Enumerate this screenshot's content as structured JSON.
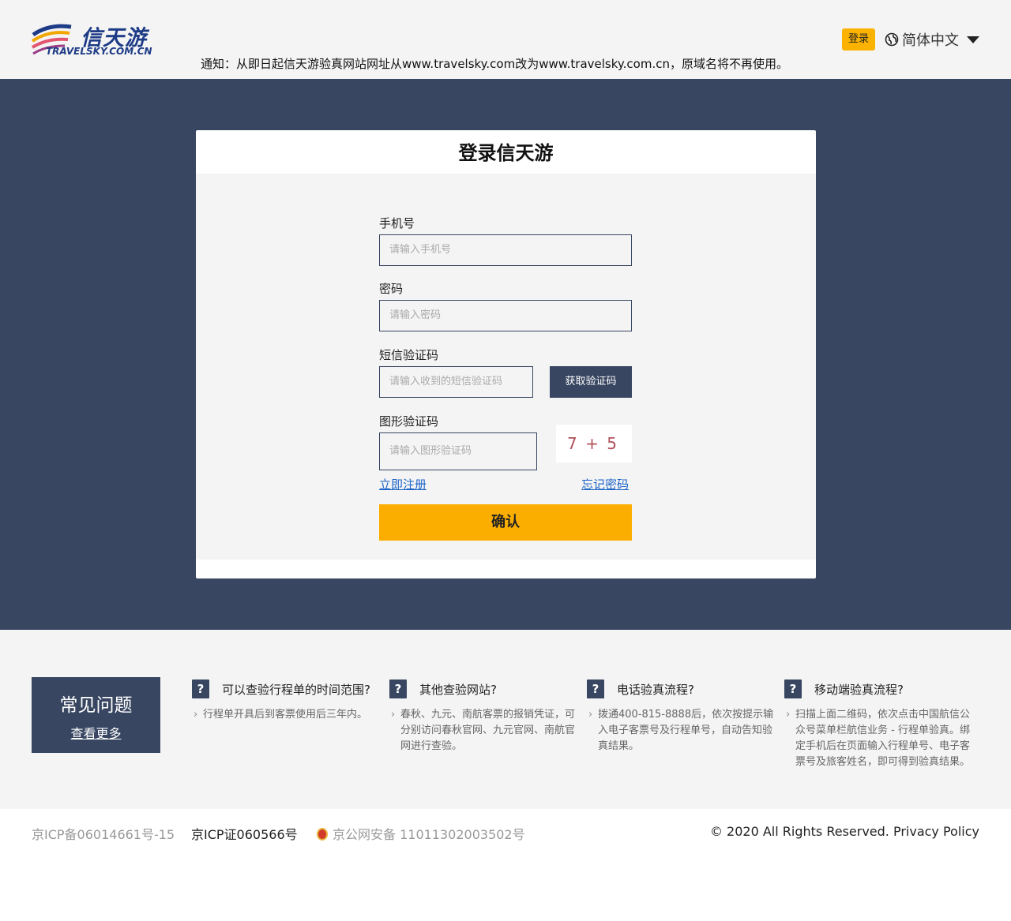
{
  "header": {
    "logo_cn": "信天游",
    "logo_en": "TRAVELSKY.COM.CN",
    "notice": "通知：从即日起信天游验真网站网址从www.travelsky.com改为www.travelsky.com.cn，原域名将不再使用。",
    "login_label": "登录",
    "language": "简体中文"
  },
  "form": {
    "title": "登录信天游",
    "phone_label": "手机号",
    "phone_placeholder": "请输入手机号",
    "password_label": "密码",
    "password_placeholder": "请输入密码",
    "sms_label": "短信验证码",
    "sms_placeholder": "请输入收到的短信验证码",
    "sms_button": "获取验证码",
    "captcha_label": "图形验证码",
    "captcha_placeholder": "请输入图形验证码",
    "captcha_text": "7 + 5",
    "register_link": "立即注册",
    "forgot_link": "忘记密码",
    "confirm_button": "确认"
  },
  "faq": {
    "title": "常见问题",
    "more": "查看更多",
    "items": [
      {
        "q": "可以查验行程单的时间范围?",
        "a": "行程单开具后到客票使用后三年内。"
      },
      {
        "q": "其他查验网站?",
        "a": "春秋、九元、南航客票的报销凭证，可分别访问春秋官网、九元官网、南航官网进行查验。"
      },
      {
        "q": "电话验真流程?",
        "a": "拨通400-815-8888后，依次按提示输入电子客票号及行程单号，自动告知验真结果。"
      },
      {
        "q": "移动端验真流程?",
        "a": "扫描上面二维码，依次点击中国航信公众号菜单栏航信业务 - 行程单验真。绑定手机后在页面输入行程单号、电子客票号及旅客姓名，即可得到验真结果。"
      }
    ],
    "icon": "question-icon"
  },
  "footer": {
    "icp1": "京ICP备06014661号-15",
    "icp2": "京ICP证060566号",
    "police": "京公网安备 11011302003502号",
    "copyright": "©  2020 All Rights Reserved. Privacy Policy"
  },
  "colors": {
    "navy": "#384661",
    "accent": "#fcae00",
    "link": "#1d64c7",
    "background": "#f4f4f4"
  }
}
